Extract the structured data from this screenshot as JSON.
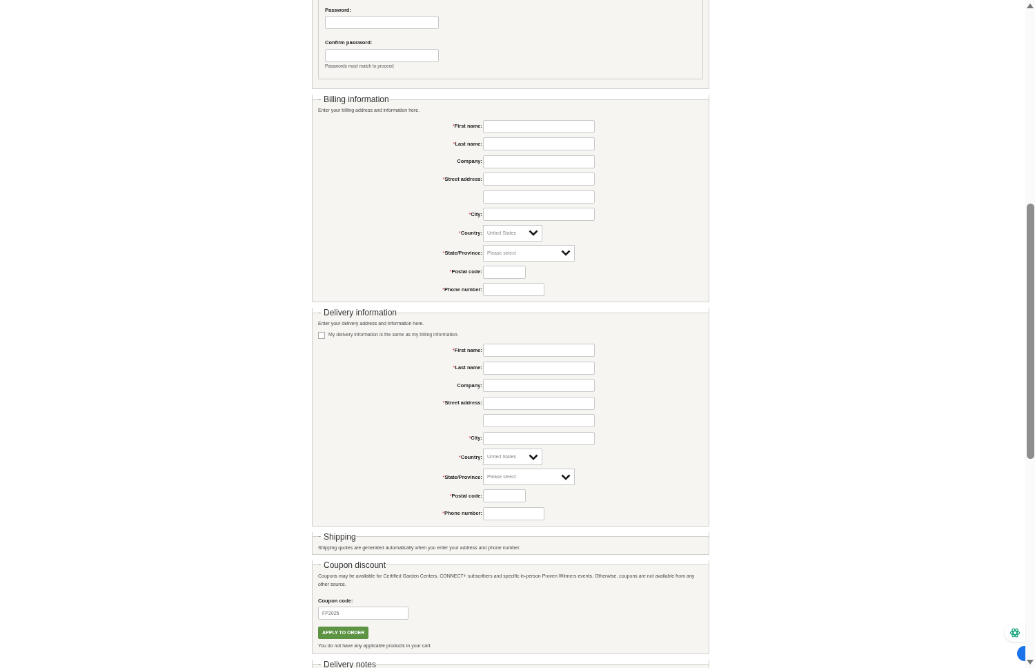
{
  "required_mark": "*",
  "account": {
    "fields": [
      {
        "label": "Password:"
      },
      {
        "label": "Confirm password:"
      }
    ],
    "hint": "Passwords must match to proceed"
  },
  "sections": [
    {
      "marker": "-",
      "title": "Billing information",
      "intro": "Enter your billing address and information here.",
      "fields": [
        {
          "label": "First name:",
          "required": true,
          "kind": "text"
        },
        {
          "label": "Last name:",
          "required": true,
          "kind": "text"
        },
        {
          "label": "Company:",
          "required": false,
          "kind": "text"
        },
        {
          "label": "Street address:",
          "required": true,
          "kind": "text"
        },
        {
          "kind": "text"
        },
        {
          "label": "City:",
          "required": true,
          "kind": "text"
        },
        {
          "label": "Country:",
          "required": true,
          "kind": "country",
          "value": "United States"
        },
        {
          "label": "State/Province:",
          "required": true,
          "kind": "state",
          "placeholder": "Please select"
        },
        {
          "label": "Postal code:",
          "required": true,
          "kind": "postal"
        },
        {
          "label": "Phone number:",
          "required": true,
          "kind": "phone"
        }
      ]
    },
    {
      "marker": "-",
      "title": "Delivery information",
      "intro": "Enter your delivery address and information here.",
      "same_as_billing": {
        "label": "My delivery information is the same as my billing information.",
        "checked": false
      },
      "fields": [
        {
          "label": "First name:",
          "required": true,
          "kind": "text"
        },
        {
          "label": "Last name:",
          "required": true,
          "kind": "text"
        },
        {
          "label": "Company:",
          "required": false,
          "kind": "text"
        },
        {
          "label": "Street address:",
          "required": true,
          "kind": "text"
        },
        {
          "kind": "text"
        },
        {
          "label": "City:",
          "required": true,
          "kind": "text"
        },
        {
          "label": "Country:",
          "required": true,
          "kind": "country",
          "value": "United States"
        },
        {
          "label": "State/Province:",
          "required": true,
          "kind": "state",
          "placeholder": "Please select"
        },
        {
          "label": "Postal code:",
          "required": true,
          "kind": "postal"
        },
        {
          "label": "Phone number:",
          "required": true,
          "kind": "phone"
        }
      ]
    },
    {
      "marker": "-",
      "title": "Shipping",
      "intro": "Shipping quotes are generated automatically when you enter your address and phone number."
    },
    {
      "marker": "-",
      "title": "Coupon discount",
      "intro": "Coupons may be available for Certified Garden Centers, CONNECT+ subscribers and specific in-person Proven Winners events. Otherwise, coupons are not available from any other source.",
      "coupon": {
        "label": "Coupon code:",
        "value": "FP2025",
        "button": "APPLY TO ORDER",
        "note": "You do not have any applicable products in your cart."
      }
    },
    {
      "marker": "-",
      "title": "Delivery notes"
    }
  ]
}
